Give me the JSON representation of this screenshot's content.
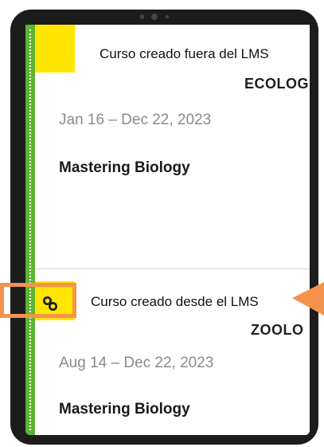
{
  "courses": [
    {
      "caption": "Curso creado fuera del LMS",
      "code": "ECOLOG",
      "dates": "Jan 16 – Dec 22, 2023",
      "product": "Mastering Biology"
    },
    {
      "caption": "Curso creado desde el LMS",
      "code": "ZOOLO",
      "dates": "Aug 14 – Dec 22, 2023",
      "product": "Mastering Biology",
      "icon": "link-icon"
    }
  ],
  "colors": {
    "accent_green": "#5cb531",
    "highlight_yellow": "#ffe600",
    "callout_orange": "#f5924b"
  }
}
